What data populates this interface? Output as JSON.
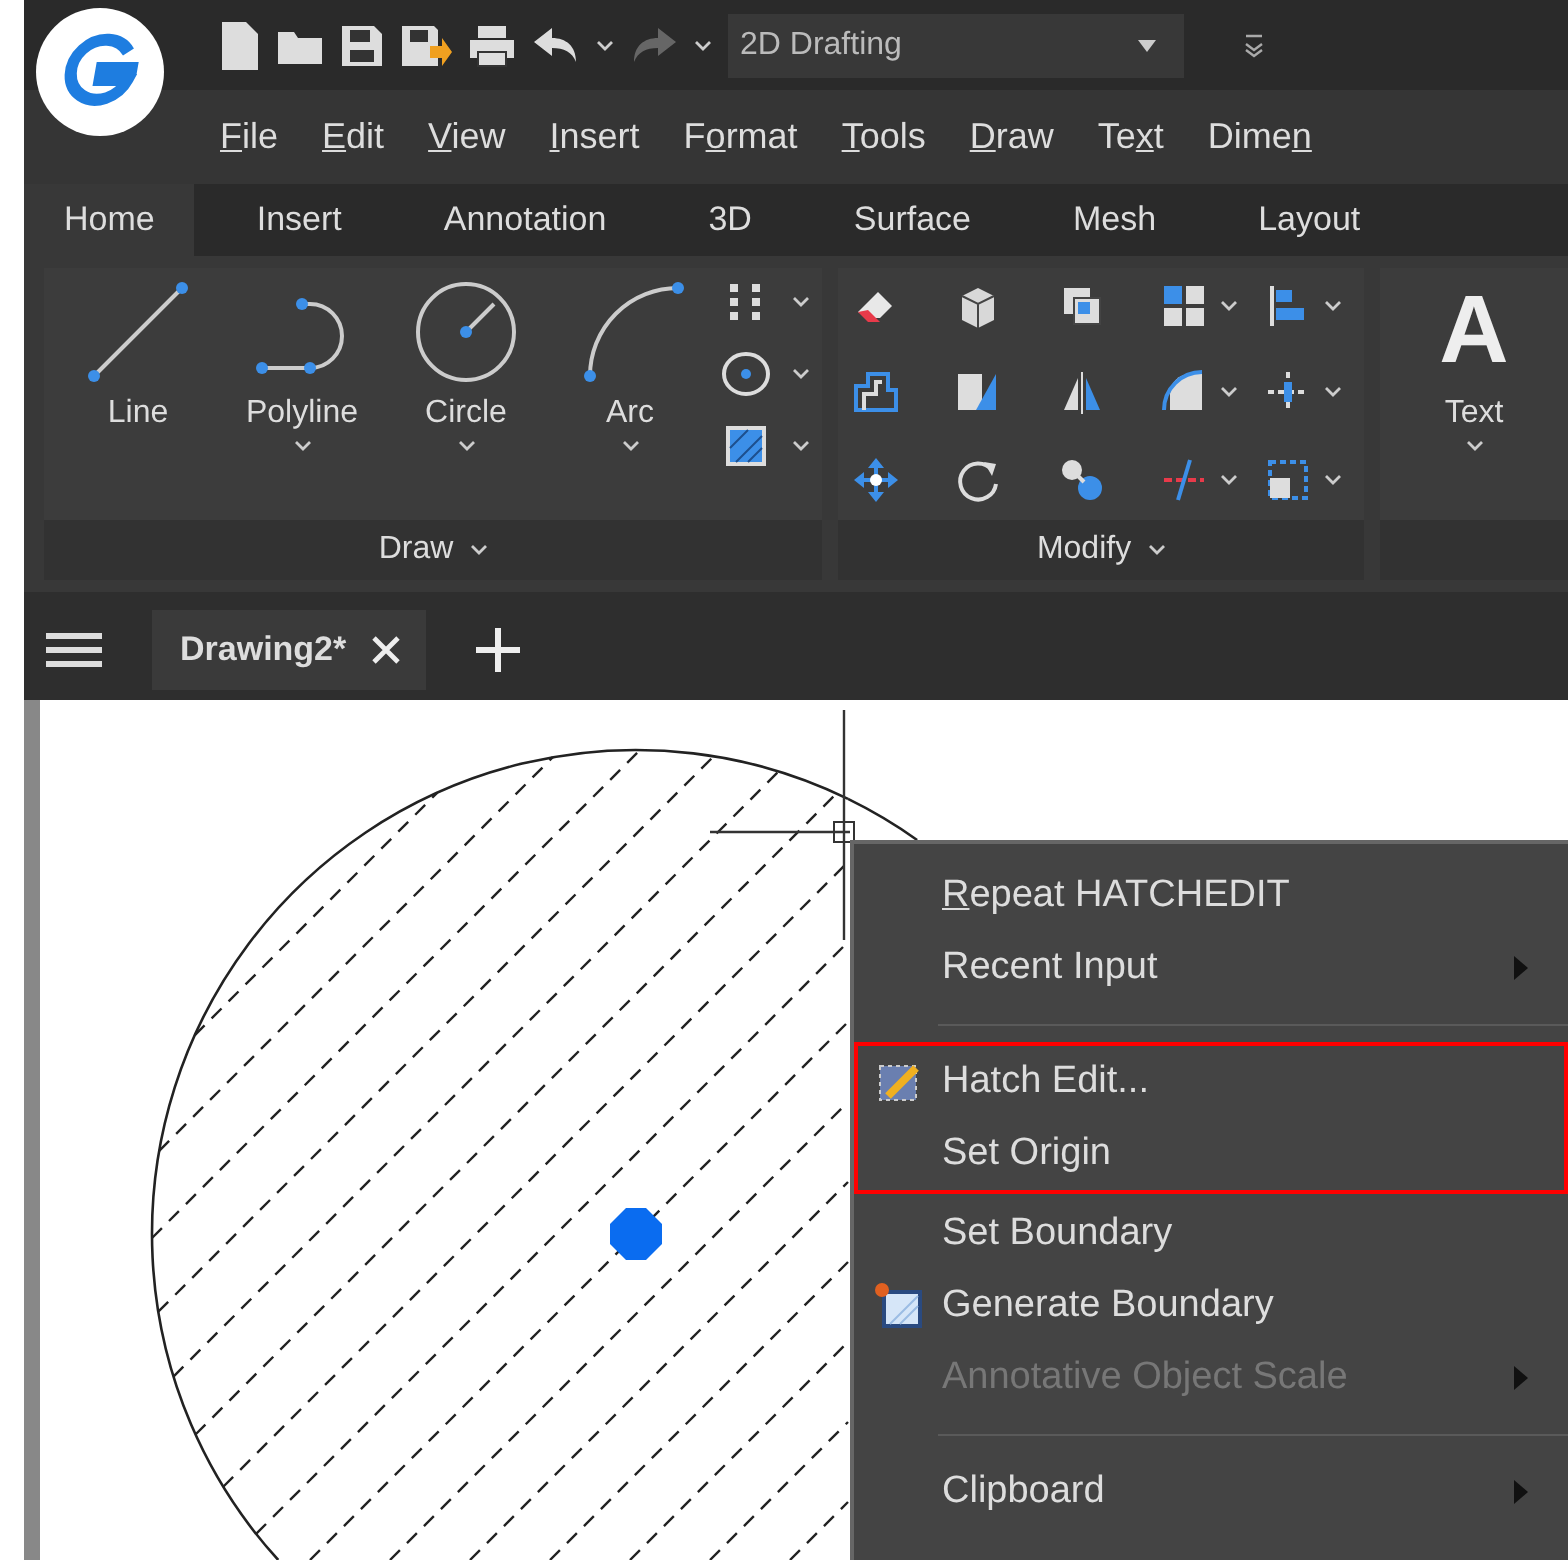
{
  "quick_access": {
    "workspace": "2D Drafting"
  },
  "menu_bar": [
    {
      "key": "F",
      "after": "ile"
    },
    {
      "key": "E",
      "after": "dit"
    },
    {
      "key": "V",
      "after": "iew"
    },
    {
      "key": "I",
      "after": "nsert"
    },
    {
      "before": "F",
      "key": "o",
      "after": "rmat"
    },
    {
      "key": "T",
      "after": "ools"
    },
    {
      "key": "D",
      "after": "raw"
    },
    {
      "before": "Te",
      "key": "x",
      "after": "t"
    },
    {
      "before": "Dime",
      "key": "n"
    }
  ],
  "ribbon_tabs": [
    {
      "label": "Home",
      "selected": true
    },
    {
      "label": "Insert",
      "selected": false
    },
    {
      "label": "Annotation",
      "selected": false
    },
    {
      "label": "3D",
      "selected": false
    },
    {
      "label": "Surface",
      "selected": false
    },
    {
      "label": "Mesh",
      "selected": false
    },
    {
      "label": "Layout",
      "selected": false
    }
  ],
  "ribbon": {
    "draw": {
      "title": "Draw",
      "tools": [
        {
          "label": "Line",
          "kind": "line",
          "dropdown": false
        },
        {
          "label": "Polyline",
          "kind": "polyline",
          "dropdown": true
        },
        {
          "label": "Circle",
          "kind": "circle",
          "dropdown": true
        },
        {
          "label": "Arc",
          "kind": "arc",
          "dropdown": true
        }
      ],
      "small_tools": [
        {
          "kind": "points",
          "dropdown": true
        },
        {
          "kind": "ellipse",
          "dropdown": true
        },
        {
          "kind": "hatch",
          "dropdown": true
        }
      ]
    },
    "modify": {
      "title": "Modify",
      "tools": [
        {
          "kind": "eraser",
          "dropdown": false
        },
        {
          "kind": "box",
          "dropdown": false
        },
        {
          "kind": "copy",
          "dropdown": false
        },
        {
          "kind": "array",
          "dropdown": true
        },
        {
          "kind": "align",
          "dropdown": true
        },
        {
          "kind": "stretch",
          "dropdown": false
        },
        {
          "kind": "scale",
          "dropdown": false
        },
        {
          "kind": "mirror",
          "dropdown": false
        },
        {
          "kind": "fillet",
          "dropdown": true
        },
        {
          "kind": "cross",
          "dropdown": true
        },
        {
          "kind": "move",
          "dropdown": false
        },
        {
          "kind": "rotate",
          "dropdown": false
        },
        {
          "kind": "join",
          "dropdown": false
        },
        {
          "kind": "trim",
          "dropdown": true
        },
        {
          "kind": "block",
          "dropdown": true
        }
      ]
    },
    "text": {
      "glyph": "A",
      "label": "Text",
      "dropdown": true
    }
  },
  "document_tabs": [
    {
      "label": "Drawing2*",
      "selected": true
    }
  ],
  "context_menu": {
    "groups": [
      {
        "sections": [
          {
            "highlighted": false,
            "items": [
              {
                "kind": "plain",
                "key": "R",
                "after": "epeat HATCHEDIT",
                "submenu": false,
                "disabled": false
              },
              {
                "kind": "plain",
                "label": "Recent Input",
                "submenu": true,
                "disabled": false
              }
            ]
          }
        ]
      },
      {
        "sections": [
          {
            "highlighted": true,
            "items": [
              {
                "kind": "hatch",
                "label": "Hatch Edit...",
                "submenu": false,
                "disabled": false
              },
              {
                "kind": "plain",
                "label": "Set Origin",
                "submenu": false,
                "disabled": false
              }
            ]
          },
          {
            "highlighted": false,
            "items": [
              {
                "kind": "plain",
                "label": "Set Boundary",
                "submenu": false,
                "disabled": false
              },
              {
                "kind": "boundary",
                "label": "Generate Boundary",
                "submenu": false,
                "disabled": false
              },
              {
                "kind": "plain",
                "label": "Annotative Object Scale",
                "submenu": true,
                "disabled": true
              }
            ]
          }
        ]
      },
      {
        "sections": [
          {
            "highlighted": false,
            "items": [
              {
                "kind": "plain",
                "label": "Clipboard",
                "submenu": true,
                "disabled": false
              }
            ]
          }
        ]
      }
    ]
  }
}
